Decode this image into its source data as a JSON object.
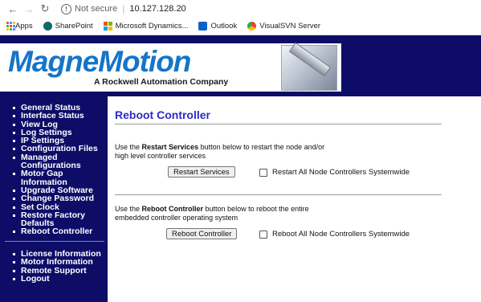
{
  "browser": {
    "security_text": "Not secure",
    "url": "10.127.128.20",
    "bookmarks": [
      {
        "label": "Apps",
        "icon": "apps-grid-icon"
      },
      {
        "label": "SharePoint",
        "icon": "sharepoint-icon"
      },
      {
        "label": "Microsoft Dynamics...",
        "icon": "microsoft-logo-icon"
      },
      {
        "label": "Outlook",
        "icon": "outlook-icon"
      },
      {
        "label": "VisualSVN Server",
        "icon": "chrome-icon"
      }
    ]
  },
  "header": {
    "logo_text": "MagneMotion",
    "tagline": "A Rockwell Automation Company"
  },
  "sidebar": {
    "items": [
      "General Status",
      "Interface Status",
      "View Log",
      "Log Settings",
      "IP Settings",
      "Configuration Files",
      "Managed Configurations",
      "Motor Gap Information",
      "Upgrade Software",
      "Change Password",
      "Set Clock",
      "Restore Factory Defaults",
      "Reboot Controller"
    ],
    "items_split": [
      [
        "General Status"
      ],
      [
        "Interface Status"
      ],
      [
        "View Log"
      ],
      [
        "Log Settings"
      ],
      [
        "IP Settings"
      ],
      [
        "Configuration Files"
      ],
      [
        "Managed",
        "Configurations"
      ],
      [
        "Motor Gap",
        "Information"
      ],
      [
        "Upgrade Software"
      ],
      [
        "Change Password"
      ],
      [
        "Set Clock"
      ],
      [
        "Restore Factory",
        "Defaults"
      ],
      [
        "Reboot Controller"
      ]
    ],
    "items2": [
      "License Information",
      "Motor Information",
      "Remote Support",
      "Logout"
    ]
  },
  "main": {
    "title": "Reboot Controller",
    "restart": {
      "desc_prefix": "Use the ",
      "desc_bold": "Restart Services",
      "desc_suffix_line1": " button below to restart the node and/or",
      "desc_line2": "high level controller services",
      "button_label": "Restart Services",
      "checkbox_label": "Restart All Node Controllers Systemwide"
    },
    "reboot": {
      "desc_prefix": "Use the ",
      "desc_bold": "Reboot Controller",
      "desc_suffix_line1": " button below to reboot the entire",
      "desc_line2": "embedded controller operating system",
      "button_label": "Reboot Controller",
      "checkbox_label": "Reboot All Node Controllers Systemwide"
    }
  },
  "colors": {
    "navy": "#0d0d68",
    "title_blue": "#2b2bc8",
    "logo_blue": "#1575c8"
  }
}
